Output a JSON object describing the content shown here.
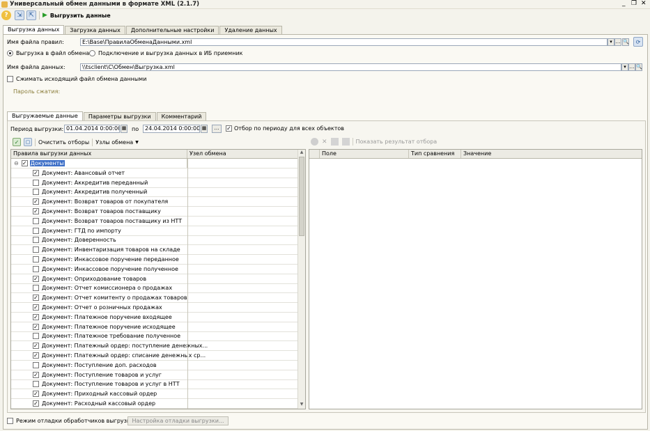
{
  "window": {
    "title": "Универсальный обмен данными в формате XML (2.1.7)"
  },
  "toolbar": {
    "export_label": "Выгрузить данные"
  },
  "main_tabs": [
    "Выгрузка данных",
    "Загрузка данных",
    "Дополнительные настройки",
    "Удаление данных"
  ],
  "rules_file": {
    "label": "Имя файла правил:",
    "value": "E:\\Base\\ПравилаОбменаДанными.xml"
  },
  "mode": {
    "option1": "Выгрузка в файл обмена",
    "option2": "Подключение и выгрузка данных в ИБ приемник"
  },
  "data_file": {
    "label": "Имя файла данных:",
    "value": "\\\\tsclient\\C\\Обмен\\Выгрузка.xml"
  },
  "compress": {
    "label": "Сжимать исходящий файл обмена данными"
  },
  "password": {
    "label": "Пароль сжатия:"
  },
  "sub_tabs": [
    "Выгружаемые данные",
    "Параметры выгрузки",
    "Комментарий"
  ],
  "period": {
    "label": "Период выгрузки:",
    "from": "01.04.2014  0:00:00",
    "to_label": "по",
    "to": "24.04.2014  0:00:00",
    "filter_label": "Отбор по периоду для всех объектов"
  },
  "left_toolbar": {
    "clear_filters": "Очистить отборы",
    "exchange_nodes": "Узлы обмена"
  },
  "right_toolbar": {
    "show_result": "Показать результат отбора"
  },
  "tree": {
    "col1": "Правила выгрузки данных",
    "col2": "Узел обмена",
    "root": "Документы",
    "items": [
      {
        "label": "Документ: Авансовый отчет",
        "checked": true
      },
      {
        "label": "Документ: Аккредитив переданный",
        "checked": false
      },
      {
        "label": "Документ: Аккредитив полученный",
        "checked": false
      },
      {
        "label": "Документ: Возврат товаров от покупателя",
        "checked": true
      },
      {
        "label": "Документ: Возврат товаров поставщику",
        "checked": true
      },
      {
        "label": "Документ: Возврат товаров поставщику из НТТ",
        "checked": false
      },
      {
        "label": "Документ: ГТД по импорту",
        "checked": false
      },
      {
        "label": "Документ: Доверенность",
        "checked": false
      },
      {
        "label": "Документ: Инвентаризация товаров на складе",
        "checked": false
      },
      {
        "label": "Документ: Инкассовое поручение переданное",
        "checked": false
      },
      {
        "label": "Документ: Инкассовое поручение полученное",
        "checked": false
      },
      {
        "label": "Документ: Оприходование товаров",
        "checked": true
      },
      {
        "label": "Документ: Отчет комиссионера о продажах",
        "checked": false
      },
      {
        "label": "Документ: Отчет комитенту о продажах товаров",
        "checked": true
      },
      {
        "label": "Документ: Отчет о розничных продажах",
        "checked": true
      },
      {
        "label": "Документ: Платежное поручение входящее",
        "checked": true
      },
      {
        "label": "Документ: Платежное поручение исходящее",
        "checked": true
      },
      {
        "label": "Документ: Платежное требование полученное",
        "checked": false
      },
      {
        "label": "Документ: Платежный ордер: поступление денежных...",
        "checked": true
      },
      {
        "label": "Документ: Платежный ордер: списание денежных ср...",
        "checked": true
      },
      {
        "label": "Документ: Поступление доп. расходов",
        "checked": false
      },
      {
        "label": "Документ: Поступление товаров и услуг",
        "checked": true
      },
      {
        "label": "Документ: Поступление товаров и услуг в НТТ",
        "checked": false
      },
      {
        "label": "Документ: Приходный кассовый ордер",
        "checked": true
      },
      {
        "label": "Документ: Расходный кассовый ордер",
        "checked": true
      }
    ]
  },
  "filter_table": {
    "col1": "Поле",
    "col2": "Тип сравнения",
    "col3": "Значение"
  },
  "footer": {
    "debug_label": "Режим отладки обработчиков выгрузки",
    "debug_button": "Настройка отладки выгрузки..."
  }
}
